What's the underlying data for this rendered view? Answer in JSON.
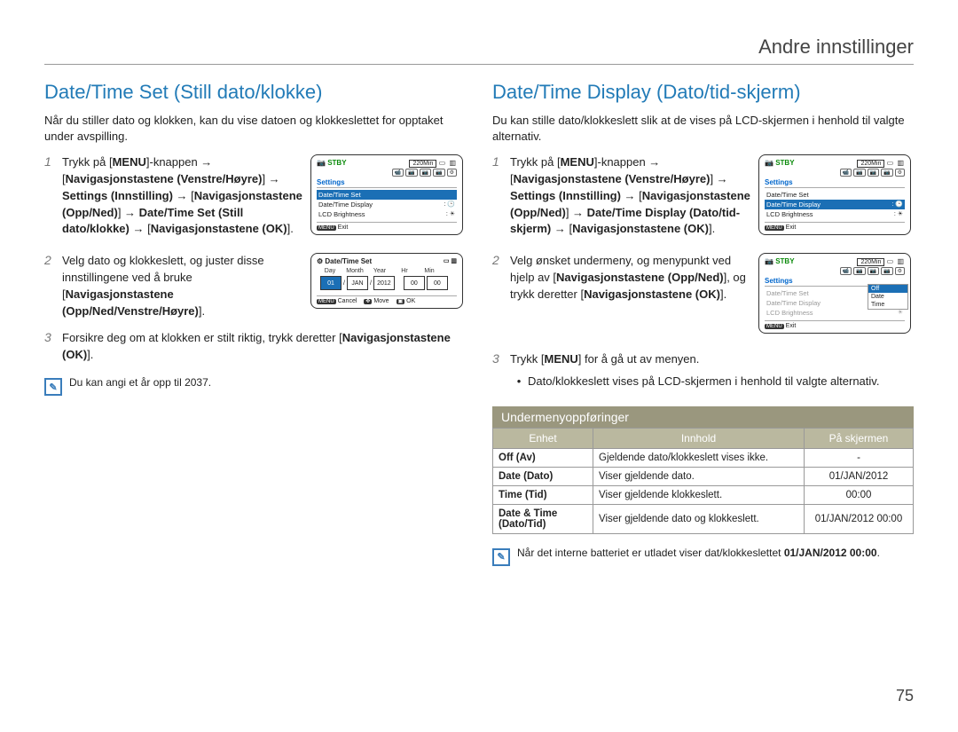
{
  "header": {
    "title": "Andre innstillinger"
  },
  "page_number": "75",
  "left": {
    "heading": "Date/Time Set (Still dato/klokke)",
    "intro": "Når du stiller dato og klokken, kan du vise datoen og klokkeslettet for opptaket under avspilling.",
    "steps": {
      "s1_a": "Trykk på [",
      "s1_menu": "MENU",
      "s1_b": "]-knappen → [",
      "s1_c": "Navigasjonstastene (Venstre/Høyre)",
      "s1_d": "] → ",
      "s1_e": "Settings (Innstilling)",
      "s1_f": " → [",
      "s1_g": "Navigasjonstastene (Opp/Ned)",
      "s1_h": "] → ",
      "s1_i": "Date/Time Set (Still dato/klokke)",
      "s1_j": " → [",
      "s1_k": "Navigasjonstastene (OK)",
      "s1_l": "].",
      "s2_a": "Velg dato og klokkeslett, og juster disse innstillingene ved å bruke [",
      "s2_b": "Navigasjonstastene (Opp/Ned/Venstre/Høyre)",
      "s2_c": "].",
      "s3_a": "Forsikre deg om at klokken er stilt riktig, trykk deretter [",
      "s3_b": "Navigasjonstastene (OK)",
      "s3_c": "]."
    },
    "note": "Du kan angi et år opp til 2037.",
    "screen1": {
      "stby": "STBY",
      "time": "220Min",
      "settings": "Settings",
      "items": [
        "Date/Time Set",
        "Date/Time Display",
        "LCD Brightness"
      ],
      "exit": "Exit",
      "menu": "MENU"
    },
    "screen2": {
      "title": "Date/Time Set",
      "labels": [
        "Day",
        "Month",
        "Year",
        "Hr",
        "Min"
      ],
      "values": [
        "01",
        "JAN",
        "2012",
        "00",
        "00"
      ],
      "cancel": "Cancel",
      "move": "Move",
      "ok": "OK",
      "menu": "MENU"
    }
  },
  "right": {
    "heading": "Date/Time Display (Dato/tid-skjerm)",
    "intro": "Du kan stille dato/klokkeslett slik at de vises på LCD-skjermen i henhold til valgte alternativ.",
    "steps": {
      "s1_a": "Trykk på [",
      "s1_menu": "MENU",
      "s1_b": "]-knappen → [",
      "s1_c": "Navigasjonstastene (Venstre/Høyre)",
      "s1_d": "] → ",
      "s1_e": "Settings (Innstilling)",
      "s1_f": " → [",
      "s1_g": "Navigasjonstastene (Opp/Ned)",
      "s1_h": "] → ",
      "s1_i": "Date/Time Display (Dato/tid-skjerm)",
      "s1_j": " → [",
      "s1_k": "Navigasjonstastene (OK)",
      "s1_l": "].",
      "s2_a": "Velg ønsket undermeny, og menypunkt ved hjelp av [",
      "s2_b": "Navigasjonstastene (Opp/Ned)",
      "s2_c": "], og trykk deretter [",
      "s2_d": "Navigasjonstastene (OK)",
      "s2_e": "].",
      "s3_a": "Trykk [",
      "s3_menu": "MENU",
      "s3_b": "] for å gå ut av menyen.",
      "s3_bullet": "Dato/klokkeslett vises på LCD-skjermen i henhold til valgte alternativ."
    },
    "screen1": {
      "stby": "STBY",
      "time": "220Min",
      "settings": "Settings",
      "items": [
        "Date/Time Set",
        "Date/Time Display",
        "LCD Brightness"
      ],
      "exit": "Exit",
      "menu": "MENU"
    },
    "screen2": {
      "stby": "STBY",
      "time": "220Min",
      "settings": "Settings",
      "items": [
        "Date/Time Set",
        "Date/Time Display",
        "LCD Brightness"
      ],
      "popup": [
        "Off",
        "Date",
        "Time"
      ],
      "exit": "Exit",
      "menu": "MENU"
    },
    "submenu": {
      "heading": "Undermenyoppføringer",
      "cols": [
        "Enhet",
        "Innhold",
        "På skjermen"
      ],
      "rows": [
        {
          "unit": "Off (Av)",
          "content": "Gjeldende dato/klokkeslett vises ikke.",
          "screen": "-"
        },
        {
          "unit": "Date (Dato)",
          "content": "Viser gjeldende dato.",
          "screen": "01/JAN/2012"
        },
        {
          "unit": "Time (Tid)",
          "content": "Viser gjeldende klokkeslett.",
          "screen": "00:00"
        },
        {
          "unit": "Date & Time (Dato/Tid)",
          "content": "Viser gjeldende dato og klokkeslett.",
          "screen": "01/JAN/2012 00:00"
        }
      ]
    },
    "note_a": "Når det interne batteriet er utladet viser dat/klokkeslettet ",
    "note_b": "01/JAN/2012 00:00",
    "note_c": "."
  }
}
